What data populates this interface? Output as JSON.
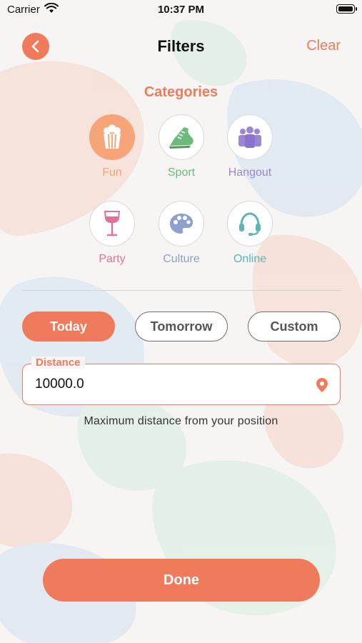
{
  "status_bar": {
    "carrier": "Carrier",
    "time": "10:37 PM"
  },
  "nav": {
    "title": "Filters",
    "clear_label": "Clear"
  },
  "categories": {
    "title": "Categories",
    "items": [
      {
        "label": "Fun",
        "icon": "popcorn-icon",
        "color": "#f6a478",
        "selected": true
      },
      {
        "label": "Sport",
        "icon": "sneaker-icon",
        "color": "#6dbb7a",
        "selected": false
      },
      {
        "label": "Hangout",
        "icon": "group-icon",
        "color": "#9b86d6",
        "selected": false
      },
      {
        "label": "Party",
        "icon": "wine-glass-icon",
        "color": "#e0719a",
        "selected": false
      },
      {
        "label": "Culture",
        "icon": "palette-icon",
        "color": "#8ea0cc",
        "selected": false
      },
      {
        "label": "Online",
        "icon": "headset-icon",
        "color": "#5bb6b4",
        "selected": false
      }
    ]
  },
  "date_options": {
    "today": "Today",
    "tomorrow": "Tomorrow",
    "custom": "Custom",
    "selected": "Today"
  },
  "distance": {
    "label": "Distance",
    "value": "10000.0",
    "help": "Maximum distance from your position"
  },
  "done_label": "Done",
  "colors": {
    "accent": "#ef7b5c",
    "selected_category": "#f6a478"
  }
}
